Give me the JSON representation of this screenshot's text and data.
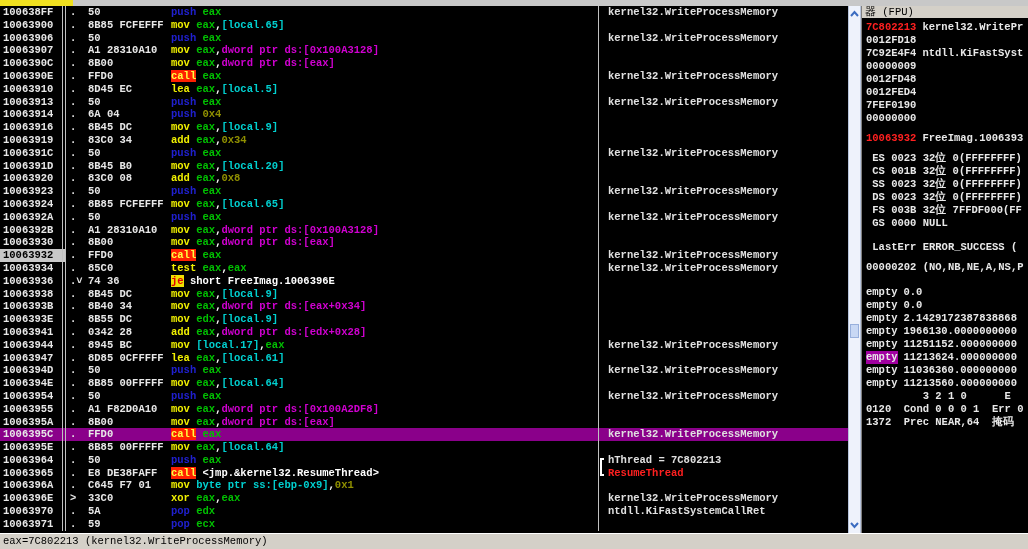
{
  "rows": [
    {
      "address": "100638FF",
      "mark": ".",
      "hex": "50",
      "asm": [
        {
          "text": "push",
          "kind": "stack"
        },
        {
          "text": " eax",
          "kind": "reg"
        }
      ],
      "comment": {
        "text": "kernel32.WriteProcessMemory",
        "kind": "note"
      },
      "selected": false,
      "marked": false
    },
    {
      "address": "10063900",
      "mark": ".",
      "hex": "8B85 FCFEFFF",
      "asm": [
        {
          "text": "mov",
          "kind": "op"
        },
        {
          "text": " eax",
          "kind": "reg"
        },
        {
          "text": ",",
          "kind": "plain"
        },
        {
          "text": "[local.65]",
          "kind": "local"
        }
      ],
      "selected": false,
      "marked": false
    },
    {
      "address": "10063906",
      "mark": ".",
      "hex": "50",
      "asm": [
        {
          "text": "push",
          "kind": "stack"
        },
        {
          "text": " eax",
          "kind": "reg"
        }
      ],
      "comment": {
        "text": "kernel32.WriteProcessMemory",
        "kind": "note"
      },
      "selected": false,
      "marked": false
    },
    {
      "address": "10063907",
      "mark": ".",
      "hex": "A1 28310A10",
      "asm": [
        {
          "text": "mov",
          "kind": "op"
        },
        {
          "text": " eax",
          "kind": "reg"
        },
        {
          "text": ",",
          "kind": "plain"
        },
        {
          "text": "dword ptr ds:[0x100A3128]",
          "kind": "mem"
        }
      ],
      "selected": false,
      "marked": false
    },
    {
      "address": "1006390C",
      "mark": ".",
      "hex": "8B00",
      "asm": [
        {
          "text": "mov",
          "kind": "op"
        },
        {
          "text": " eax",
          "kind": "reg"
        },
        {
          "text": ",",
          "kind": "plain"
        },
        {
          "text": "dword ptr ds:[eax]",
          "kind": "mem"
        }
      ],
      "selected": false,
      "marked": false
    },
    {
      "address": "1006390E",
      "mark": ".",
      "hex": "FFD0",
      "asm": [
        {
          "text": "call",
          "kind": "call"
        },
        {
          "text": " eax",
          "kind": "reg"
        }
      ],
      "comment": {
        "text": "kernel32.WriteProcessMemory",
        "kind": "note"
      },
      "selected": false,
      "marked": false
    },
    {
      "address": "10063910",
      "mark": ".",
      "hex": "8D45 EC",
      "asm": [
        {
          "text": "lea",
          "kind": "op"
        },
        {
          "text": " eax",
          "kind": "reg"
        },
        {
          "text": ",",
          "kind": "plain"
        },
        {
          "text": "[local.5]",
          "kind": "local"
        }
      ],
      "selected": false,
      "marked": false
    },
    {
      "address": "10063913",
      "mark": ".",
      "hex": "50",
      "asm": [
        {
          "text": "push",
          "kind": "stack"
        },
        {
          "text": " eax",
          "kind": "reg"
        }
      ],
      "comment": {
        "text": "kernel32.WriteProcessMemory",
        "kind": "note"
      },
      "selected": false,
      "marked": false
    },
    {
      "address": "10063914",
      "mark": ".",
      "hex": "6A 04",
      "asm": [
        {
          "text": "push",
          "kind": "stack"
        },
        {
          "text": " 0x4",
          "kind": "imm"
        }
      ],
      "selected": false,
      "marked": false
    },
    {
      "address": "10063916",
      "mark": ".",
      "hex": "8B45 DC",
      "asm": [
        {
          "text": "mov",
          "kind": "op"
        },
        {
          "text": " eax",
          "kind": "reg"
        },
        {
          "text": ",",
          "kind": "plain"
        },
        {
          "text": "[local.9]",
          "kind": "local"
        }
      ],
      "selected": false,
      "marked": false
    },
    {
      "address": "10063919",
      "mark": ".",
      "hex": "83C0 34",
      "asm": [
        {
          "text": "add",
          "kind": "op"
        },
        {
          "text": " eax",
          "kind": "reg"
        },
        {
          "text": ",",
          "kind": "plain"
        },
        {
          "text": "0x34",
          "kind": "imm"
        }
      ],
      "selected": false,
      "marked": false
    },
    {
      "address": "1006391C",
      "mark": ".",
      "hex": "50",
      "asm": [
        {
          "text": "push",
          "kind": "stack"
        },
        {
          "text": " eax",
          "kind": "reg"
        }
      ],
      "comment": {
        "text": "kernel32.WriteProcessMemory",
        "kind": "note"
      },
      "selected": false,
      "marked": false
    },
    {
      "address": "1006391D",
      "mark": ".",
      "hex": "8B45 B0",
      "asm": [
        {
          "text": "mov",
          "kind": "op"
        },
        {
          "text": " eax",
          "kind": "reg"
        },
        {
          "text": ",",
          "kind": "plain"
        },
        {
          "text": "[local.20]",
          "kind": "local"
        }
      ],
      "selected": false,
      "marked": false
    },
    {
      "address": "10063920",
      "mark": ".",
      "hex": "83C0 08",
      "asm": [
        {
          "text": "add",
          "kind": "op"
        },
        {
          "text": " eax",
          "kind": "reg"
        },
        {
          "text": ",",
          "kind": "plain"
        },
        {
          "text": "0x8",
          "kind": "imm"
        }
      ],
      "selected": false,
      "marked": false
    },
    {
      "address": "10063923",
      "mark": ".",
      "hex": "50",
      "asm": [
        {
          "text": "push",
          "kind": "stack"
        },
        {
          "text": " eax",
          "kind": "reg"
        }
      ],
      "comment": {
        "text": "kernel32.WriteProcessMemory",
        "kind": "note"
      },
      "selected": false,
      "marked": false
    },
    {
      "address": "10063924",
      "mark": ".",
      "hex": "8B85 FCFEFFF",
      "asm": [
        {
          "text": "mov",
          "kind": "op"
        },
        {
          "text": " eax",
          "kind": "reg"
        },
        {
          "text": ",",
          "kind": "plain"
        },
        {
          "text": "[local.65]",
          "kind": "local"
        }
      ],
      "selected": false,
      "marked": false
    },
    {
      "address": "1006392A",
      "mark": ".",
      "hex": "50",
      "asm": [
        {
          "text": "push",
          "kind": "stack"
        },
        {
          "text": " eax",
          "kind": "reg"
        }
      ],
      "comment": {
        "text": "kernel32.WriteProcessMemory",
        "kind": "note"
      },
      "selected": false,
      "marked": false
    },
    {
      "address": "1006392B",
      "mark": ".",
      "hex": "A1 28310A10",
      "asm": [
        {
          "text": "mov",
          "kind": "op"
        },
        {
          "text": " eax",
          "kind": "reg"
        },
        {
          "text": ",",
          "kind": "plain"
        },
        {
          "text": "dword ptr ds:[0x100A3128]",
          "kind": "mem"
        }
      ],
      "selected": false,
      "marked": false
    },
    {
      "address": "10063930",
      "mark": ".",
      "hex": "8B00",
      "asm": [
        {
          "text": "mov",
          "kind": "op"
        },
        {
          "text": " eax",
          "kind": "reg"
        },
        {
          "text": ",",
          "kind": "plain"
        },
        {
          "text": "dword ptr ds:[eax]",
          "kind": "mem"
        }
      ],
      "selected": false,
      "marked": false
    },
    {
      "address": "10063932",
      "mark": ".",
      "hex": "FFD0",
      "asm": [
        {
          "text": "call",
          "kind": "call"
        },
        {
          "text": " eax",
          "kind": "reg"
        }
      ],
      "comment": {
        "text": "kernel32.WriteProcessMemory",
        "kind": "note"
      },
      "selected": false,
      "marked": true
    },
    {
      "address": "10063934",
      "mark": ".",
      "hex": "85C0",
      "asm": [
        {
          "text": "test",
          "kind": "op"
        },
        {
          "text": " eax",
          "kind": "reg"
        },
        {
          "text": ",",
          "kind": "plain"
        },
        {
          "text": "eax",
          "kind": "reg"
        }
      ],
      "comment": {
        "text": "kernel32.WriteProcessMemory",
        "kind": "note"
      },
      "selected": false,
      "marked": false
    },
    {
      "address": "10063936",
      "mark": ".˅",
      "hex": "74 36",
      "asm": [
        {
          "text": "je",
          "kind": "jump"
        },
        {
          "text": " short FreeImag.1006396E",
          "kind": "plain"
        }
      ],
      "selected": false,
      "marked": false
    },
    {
      "address": "10063938",
      "mark": ".",
      "hex": "8B45 DC",
      "asm": [
        {
          "text": "mov",
          "kind": "op"
        },
        {
          "text": " eax",
          "kind": "reg"
        },
        {
          "text": ",",
          "kind": "plain"
        },
        {
          "text": "[local.9]",
          "kind": "local"
        }
      ],
      "selected": false,
      "marked": false
    },
    {
      "address": "1006393B",
      "mark": ".",
      "hex": "8B40 34",
      "asm": [
        {
          "text": "mov",
          "kind": "op"
        },
        {
          "text": " eax",
          "kind": "reg"
        },
        {
          "text": ",",
          "kind": "plain"
        },
        {
          "text": "dword ptr ds:[eax+0x34]",
          "kind": "mem"
        }
      ],
      "selected": false,
      "marked": false
    },
    {
      "address": "1006393E",
      "mark": ".",
      "hex": "8B55 DC",
      "asm": [
        {
          "text": "mov",
          "kind": "op"
        },
        {
          "text": " edx",
          "kind": "reg"
        },
        {
          "text": ",",
          "kind": "plain"
        },
        {
          "text": "[local.9]",
          "kind": "local"
        }
      ],
      "selected": false,
      "marked": false
    },
    {
      "address": "10063941",
      "mark": ".",
      "hex": "0342 28",
      "asm": [
        {
          "text": "add",
          "kind": "op"
        },
        {
          "text": " eax",
          "kind": "reg"
        },
        {
          "text": ",",
          "kind": "plain"
        },
        {
          "text": "dword ptr ds:[edx+0x28]",
          "kind": "mem"
        }
      ],
      "selected": false,
      "marked": false
    },
    {
      "address": "10063944",
      "mark": ".",
      "hex": "8945 BC",
      "asm": [
        {
          "text": "mov",
          "kind": "op"
        },
        {
          "text": " [local.17]",
          "kind": "local"
        },
        {
          "text": ",",
          "kind": "plain"
        },
        {
          "text": "eax",
          "kind": "reg"
        }
      ],
      "comment": {
        "text": "kernel32.WriteProcessMemory",
        "kind": "note"
      },
      "selected": false,
      "marked": false
    },
    {
      "address": "10063947",
      "mark": ".",
      "hex": "8D85 0CFFFFF",
      "asm": [
        {
          "text": "lea",
          "kind": "op"
        },
        {
          "text": " eax",
          "kind": "reg"
        },
        {
          "text": ",",
          "kind": "plain"
        },
        {
          "text": "[local.61]",
          "kind": "local"
        }
      ],
      "selected": false,
      "marked": false
    },
    {
      "address": "1006394D",
      "mark": ".",
      "hex": "50",
      "asm": [
        {
          "text": "push",
          "kind": "stack"
        },
        {
          "text": " eax",
          "kind": "reg"
        }
      ],
      "comment": {
        "text": "kernel32.WriteProcessMemory",
        "kind": "note"
      },
      "selected": false,
      "marked": false
    },
    {
      "address": "1006394E",
      "mark": ".",
      "hex": "8B85 00FFFFF",
      "asm": [
        {
          "text": "mov",
          "kind": "op"
        },
        {
          "text": " eax",
          "kind": "reg"
        },
        {
          "text": ",",
          "kind": "plain"
        },
        {
          "text": "[local.64]",
          "kind": "local"
        }
      ],
      "selected": false,
      "marked": false
    },
    {
      "address": "10063954",
      "mark": ".",
      "hex": "50",
      "asm": [
        {
          "text": "push",
          "kind": "stack"
        },
        {
          "text": " eax",
          "kind": "reg"
        }
      ],
      "comment": {
        "text": "kernel32.WriteProcessMemory",
        "kind": "note"
      },
      "selected": false,
      "marked": false
    },
    {
      "address": "10063955",
      "mark": ".",
      "hex": "A1 F82D0A10",
      "asm": [
        {
          "text": "mov",
          "kind": "op"
        },
        {
          "text": " eax",
          "kind": "reg"
        },
        {
          "text": ",",
          "kind": "plain"
        },
        {
          "text": "dword ptr ds:[0x100A2DF8]",
          "kind": "mem"
        }
      ],
      "selected": false,
      "marked": false
    },
    {
      "address": "1006395A",
      "mark": ".",
      "hex": "8B00",
      "asm": [
        {
          "text": "mov",
          "kind": "op"
        },
        {
          "text": " eax",
          "kind": "reg"
        },
        {
          "text": ",",
          "kind": "plain"
        },
        {
          "text": "dword ptr ds:[eax]",
          "kind": "mem"
        }
      ],
      "selected": false,
      "marked": false
    },
    {
      "address": "1006395C",
      "mark": ".",
      "hex": "FFD0",
      "asm": [
        {
          "text": "call",
          "kind": "call"
        },
        {
          "text": " eax",
          "kind": "reg"
        }
      ],
      "comment": {
        "text": "kernel32.WriteProcessMemory",
        "kind": "note"
      },
      "selected": true,
      "marked": false
    },
    {
      "address": "1006395E",
      "mark": ".",
      "hex": "8B85 00FFFFF",
      "asm": [
        {
          "text": "mov",
          "kind": "op"
        },
        {
          "text": " eax",
          "kind": "reg"
        },
        {
          "text": ",",
          "kind": "plain"
        },
        {
          "text": "[local.64]",
          "kind": "local"
        }
      ],
      "selected": false,
      "marked": false
    },
    {
      "address": "10063964",
      "mark": ".",
      "hex": "50",
      "asm": [
        {
          "text": "push",
          "kind": "stack"
        },
        {
          "text": " eax",
          "kind": "reg"
        }
      ],
      "comment": {
        "text": "hThread = 7C802213",
        "kind": "note",
        "bracket_open": true,
        "bracket_close": false
      },
      "selected": false,
      "marked": false
    },
    {
      "address": "10063965",
      "mark": ".",
      "hex": "E8 DE38FAFF",
      "asm": [
        {
          "text": "call",
          "kind": "call"
        },
        {
          "text": " <jmp.&kernel32.ResumeThread>",
          "kind": "plain"
        }
      ],
      "comment": {
        "text": "ResumeThread",
        "kind": "api",
        "bracket_open": false,
        "bracket_close": true
      },
      "selected": false,
      "marked": false
    },
    {
      "address": "1006396A",
      "mark": ".",
      "hex": "C645 F7 01",
      "asm": [
        {
          "text": "mov",
          "kind": "op"
        },
        {
          "text": " byte ptr ss:[ebp-0x9]",
          "kind": "local"
        },
        {
          "text": ",",
          "kind": "plain"
        },
        {
          "text": "0x1",
          "kind": "imm"
        }
      ],
      "selected": false,
      "marked": false
    },
    {
      "address": "1006396E",
      "mark": ">",
      "hex": "33C0",
      "asm": [
        {
          "text": "xor",
          "kind": "op"
        },
        {
          "text": " eax",
          "kind": "reg"
        },
        {
          "text": ",",
          "kind": "plain"
        },
        {
          "text": "eax",
          "kind": "reg"
        }
      ],
      "comment": {
        "text": "kernel32.WriteProcessMemory",
        "kind": "note"
      },
      "selected": false,
      "marked": false
    },
    {
      "address": "10063970",
      "mark": ".",
      "hex": "5A",
      "asm": [
        {
          "text": "pop",
          "kind": "stack"
        },
        {
          "text": " edx",
          "kind": "reg"
        }
      ],
      "comment": {
        "text": "ntdll.KiFastSystemCallRet",
        "kind": "note"
      },
      "selected": false,
      "marked": false
    },
    {
      "address": "10063971",
      "mark": ".",
      "hex": "59",
      "asm": [
        {
          "text": "pop",
          "kind": "stack"
        },
        {
          "text": " ecx",
          "kind": "reg"
        }
      ],
      "selected": false,
      "marked": false
    }
  ],
  "status_bar": "eax=7C802213 (kernel32.WriteProcessMemory)",
  "registers": {
    "title": "器 (FPU)",
    "general": [
      {
        "value": "7C802213",
        "changed": true,
        "note": "kernel32.WritePr"
      },
      {
        "value": "0012FD18",
        "changed": false
      },
      {
        "value": "7C92E4F4",
        "changed": false,
        "note": "ntdll.KiFastSyst"
      },
      {
        "value": "00000009",
        "changed": false
      },
      {
        "value": "0012FD48",
        "changed": false
      },
      {
        "value": "0012FED4",
        "changed": false
      },
      {
        "value": "7FEF0190",
        "changed": false
      },
      {
        "value": "00000000",
        "changed": false
      }
    ],
    "eip": {
      "value": "10063932",
      "changed": true,
      "note": "FreeImag.1006393"
    },
    "segments": [
      " ES 0023 32位 0(FFFFFFFF)",
      " CS 001B 32位 0(FFFFFFFF)",
      " SS 0023 32位 0(FFFFFFFF)",
      " DS 0023 32位 0(FFFFFFFF)",
      " FS 003B 32位 7FFDF000(FF",
      " GS 0000 NULL"
    ],
    "last_error": " LastErr ERROR_SUCCESS (",
    "flags": "00000202 (NO,NB,NE,A,NS,P",
    "fpu": [
      {
        "tag": "empty",
        "value": "0.0",
        "selected": false
      },
      {
        "tag": "empty",
        "value": "0.0",
        "selected": false
      },
      {
        "tag": "empty",
        "value": "2.1429172387838868",
        "selected": false
      },
      {
        "tag": "empty",
        "value": "1966130.0000000000",
        "selected": false
      },
      {
        "tag": "empty",
        "value": "11251152.000000000",
        "selected": false
      },
      {
        "tag": "empty",
        "value": "11213624.000000000",
        "selected": true
      },
      {
        "tag": "empty",
        "value": "11036360.000000000",
        "selected": false
      },
      {
        "tag": "empty",
        "value": "11213560.000000000",
        "selected": false
      }
    ],
    "fpu_status": [
      "         3 2 1 0      E",
      "0120  Cond 0 0 0 1  Err 0",
      "1372  Prec NEAR,64  掩码"
    ]
  }
}
